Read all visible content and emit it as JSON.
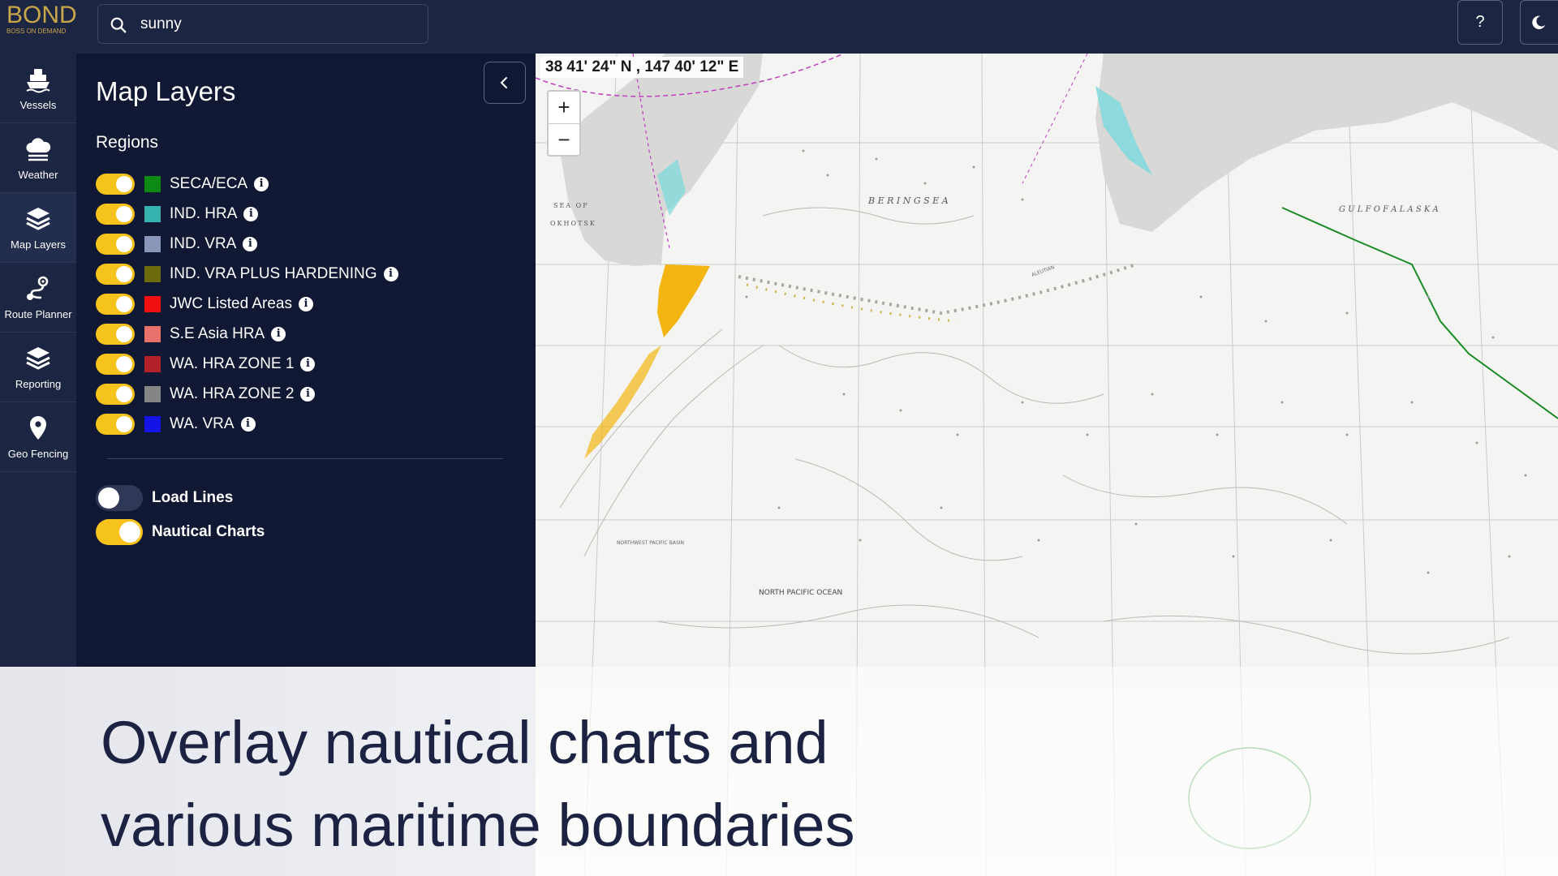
{
  "app": {
    "brand": "BOND",
    "tagline": "BOSS ON DEMAND"
  },
  "search": {
    "value": "sunny"
  },
  "topbar": {
    "help_label": "?"
  },
  "rail": {
    "items": [
      {
        "label": "Vessels",
        "icon": "ship-icon"
      },
      {
        "label": "Weather",
        "icon": "cloud-icon"
      },
      {
        "label": "Map Layers",
        "icon": "layers-icon"
      },
      {
        "label": "Route Planner",
        "icon": "route-icon"
      },
      {
        "label": "Reporting",
        "icon": "reporting-layers-icon"
      },
      {
        "label": "Geo Fencing",
        "icon": "location-pin-icon"
      }
    ],
    "active": "Map Layers"
  },
  "panel": {
    "title": "Map Layers",
    "regions_title": "Regions",
    "regions": [
      {
        "label": "SECA/ECA",
        "color": "#0c8a14",
        "on": true
      },
      {
        "label": "IND. HRA",
        "color": "#36b3b0",
        "on": true
      },
      {
        "label": "IND. VRA",
        "color": "#8a97b8",
        "on": true
      },
      {
        "label": "IND. VRA PLUS HARDENING",
        "color": "#6b6b0c",
        "on": true
      },
      {
        "label": "JWC Listed Areas",
        "color": "#f01010",
        "on": true
      },
      {
        "label": "S.E Asia HRA",
        "color": "#e8736c",
        "on": true
      },
      {
        "label": "WA. HRA ZONE 1",
        "color": "#b32228",
        "on": true
      },
      {
        "label": "WA. HRA ZONE 2",
        "color": "#858585",
        "on": true
      },
      {
        "label": "WA. VRA",
        "color": "#1414e6",
        "on": true
      }
    ],
    "load_lines": {
      "label": "Load Lines",
      "on": false
    },
    "nautical_charts": {
      "label": "Nautical Charts",
      "on": true
    }
  },
  "map": {
    "coordinates": "38 41' 24\" N , 147 40' 12\" E",
    "zoom_in": "+",
    "zoom_out": "−",
    "chart_labels": {
      "sea_of_okhotsk_1": "SEA OF",
      "sea_of_okhotsk_2": "OKHOTSK",
      "bering_sea": "B E R I N G   S E A",
      "gulf_of_alaska": "G U L F   O F   A L A S K A",
      "north_pacific": "NORTH PACIFIC OCEAN",
      "northwest_pacific_basin": "NORTHWEST PACIFIC BASIN",
      "aleutian": "ALEUTIAN"
    }
  },
  "caption": {
    "line1": "Overlay nautical charts and",
    "line2": "various maritime boundaries"
  }
}
